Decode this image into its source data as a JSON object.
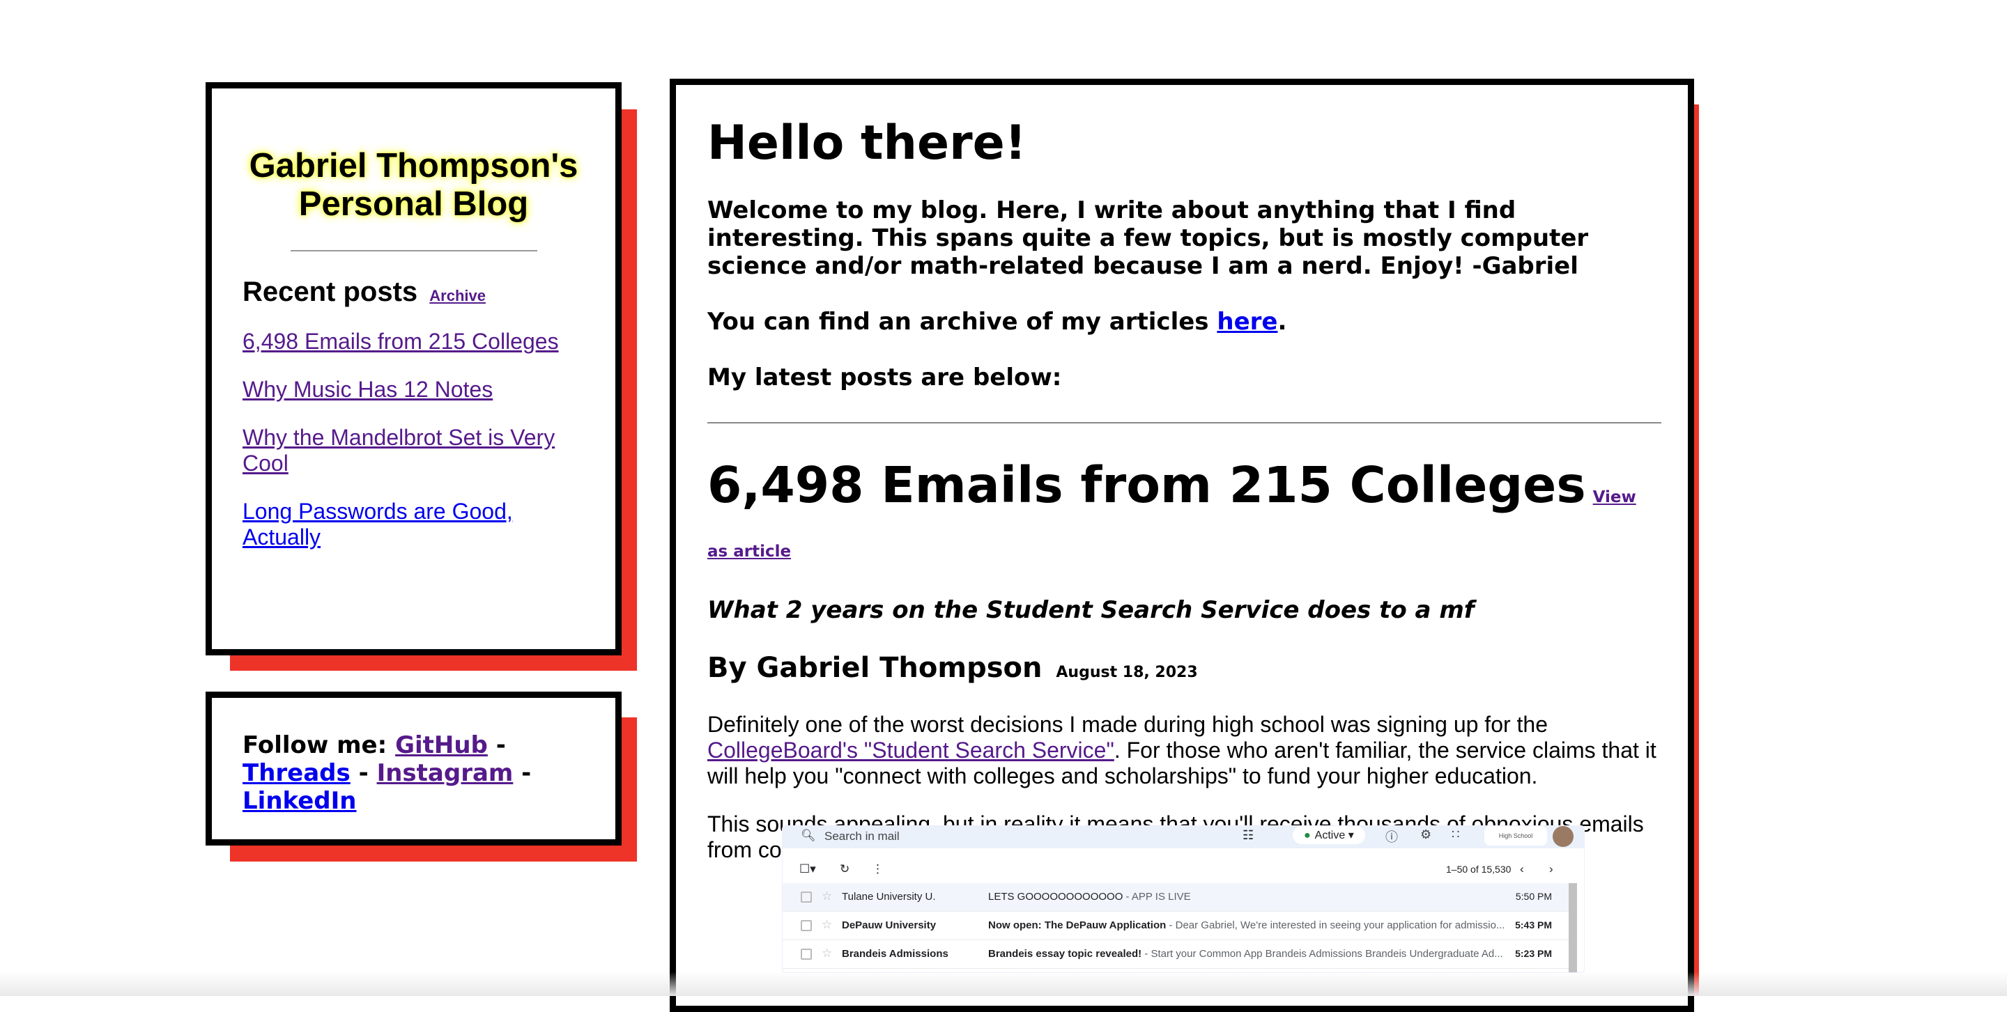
{
  "sidebar": {
    "blog_title": "Gabriel Thompson's Personal Blog",
    "recent_heading": "Recent posts",
    "archive_link": "Archive",
    "recent_posts": [
      "6,498 Emails from 215 Colleges",
      "Why Music Has 12 Notes",
      "Why the Mandelbrot Set is Very Cool",
      "Long Passwords are Good, Actually"
    ]
  },
  "follow": {
    "label": "Follow me:",
    "links": [
      "GitHub",
      "Threads",
      "Instagram",
      "LinkedIn"
    ],
    "separator": "-"
  },
  "main": {
    "greeting": "Hello there!",
    "intro": "Welcome to my blog. Here, I write about anything that I find interesting. This spans quite a few topics, but is mostly computer science and/or math-related because I am a nerd. Enjoy! -Gabriel",
    "archive_prefix": "You can find an archive of my articles ",
    "archive_link": "here",
    "archive_suffix": ".",
    "latest_label": "My latest posts are below:",
    "post": {
      "title": "6,498 Emails from 215 Colleges",
      "view_link": "View as article",
      "subtitle": "What 2 years on the Student Search Service does to a mf",
      "author": "By Gabriel Thompson",
      "date": "August 18, 2023",
      "p1_before": "Definitely one of the worst decisions I made during high school was signing up for the ",
      "p1_link": "CollegeBoard's \"Student Search Service\"",
      "p1_after": ". For those who aren't familiar, the service claims that it will help you \"connect with colleges and scholarships\" to fund your higher education.",
      "p2": "This sounds appealing, but in reality it means that you'll receive thousands of obnoxious emails from colleges telling you to apply. Emails like this one:"
    }
  },
  "gmail": {
    "search_placeholder": "Search in mail",
    "status": "Active",
    "school_label": "High School",
    "pagination": "1–50 of 15,530",
    "rows": [
      {
        "sender": "Tulane University U.",
        "subject": "LETS GOOOOOOOOOOOO",
        "snippet": " - APP IS LIVE",
        "time": "5:50 PM"
      },
      {
        "sender": "DePauw University",
        "subject": "Now open: The DePauw Application",
        "snippet": " - Dear Gabriel, We're interested in seeing your application for admissio...",
        "time": "5:43 PM"
      },
      {
        "sender": "Brandeis Admissions",
        "subject": "Brandeis essay topic revealed!",
        "snippet": " - Start your Common App Brandeis Admissions Brandeis Undergraduate Ad...",
        "time": "5:23 PM"
      }
    ]
  },
  "colors": {
    "shadow": "#ee3328",
    "highlight": "#f7ff4a",
    "link": "#0000ee",
    "visited_link": "#551a8b"
  }
}
